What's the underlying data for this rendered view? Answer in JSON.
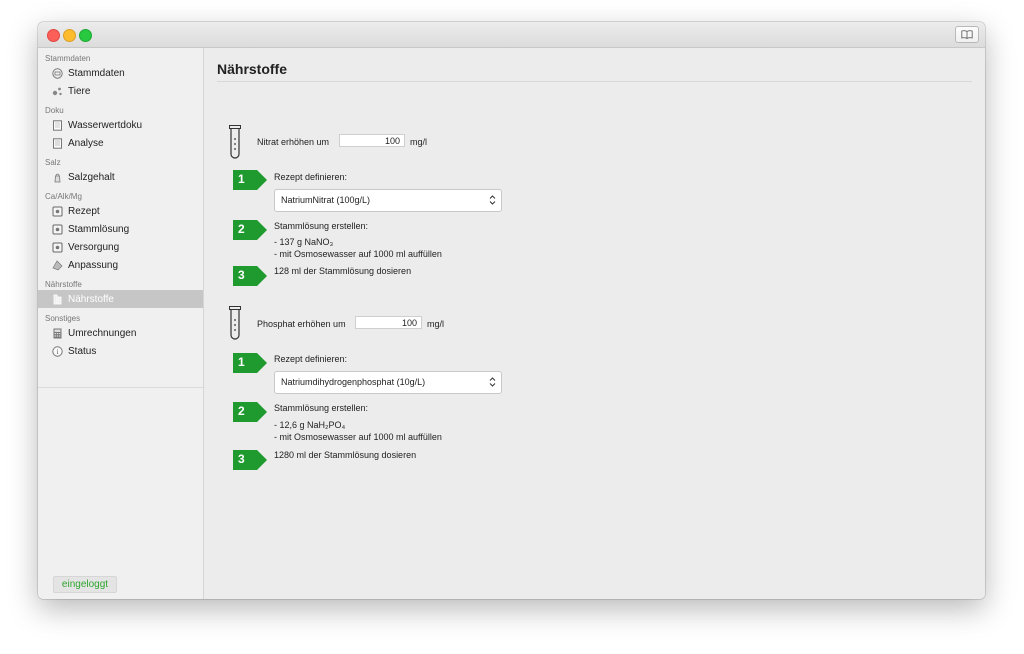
{
  "colors": {
    "accent_green": "#1e9a2f",
    "login_green": "#2fa52f",
    "selected_bg": "#c6c6c6"
  },
  "sidebar": {
    "sections": [
      {
        "title": "Stammdaten",
        "items": [
          {
            "label": "Stammdaten",
            "icon": "drawer-icon"
          },
          {
            "label": "Tiere",
            "icon": "animals-icon"
          }
        ]
      },
      {
        "title": "Doku",
        "items": [
          {
            "label": "Wasserwertdoku",
            "icon": "notebook-icon"
          },
          {
            "label": "Analyse",
            "icon": "notebook-icon"
          }
        ]
      },
      {
        "title": "Salz",
        "items": [
          {
            "label": "Salzgehalt",
            "icon": "salt-icon"
          }
        ]
      },
      {
        "title": "Ca/Alk/Mg",
        "items": [
          {
            "label": "Rezept",
            "icon": "recipe-icon"
          },
          {
            "label": "Stammlösung",
            "icon": "recipe-icon"
          },
          {
            "label": "Versorgung",
            "icon": "recipe-icon"
          },
          {
            "label": "Anpassung",
            "icon": "adjust-icon"
          }
        ]
      },
      {
        "title": "Nährstoffe",
        "items": [
          {
            "label": "Nährstoffe",
            "icon": "nutrient-icon",
            "selected": true
          }
        ]
      },
      {
        "title": "Sonstiges",
        "items": [
          {
            "label": "Umrechnungen",
            "icon": "calculator-icon"
          },
          {
            "label": "Status",
            "icon": "info-icon"
          }
        ]
      }
    ],
    "login_label": "eingeloggt"
  },
  "main": {
    "title": "Nährstoffe",
    "nitrat": {
      "label": "Nitrat erhöhen um",
      "value": "100",
      "unit": "mg/l",
      "step1": {
        "number": "1",
        "label": "Rezept definieren:",
        "select_value": "NatriumNitrat (100g/L)"
      },
      "step2": {
        "number": "2",
        "label": "Stammlösung erstellen:",
        "line1": "- 137 g NaNO₃",
        "line2": "- mit Osmosewasser auf 1000 ml auffüllen"
      },
      "step3": {
        "number": "3",
        "label": "128 ml der Stammlösung dosieren"
      }
    },
    "phosphat": {
      "label": "Phosphat erhöhen um",
      "value": "100",
      "unit": "mg/l",
      "step1": {
        "number": "1",
        "label": "Rezept definieren:",
        "select_value": "Natriumdihydrogenphosphat (10g/L)"
      },
      "step2": {
        "number": "2",
        "label": "Stammlösung erstellen:",
        "line1": "- 12,6 g NaH₂PO₄",
        "line2": "- mit Osmosewasser auf 1000 ml auffüllen"
      },
      "step3": {
        "number": "3",
        "label": "1280 ml der Stammlösung dosieren"
      }
    }
  }
}
